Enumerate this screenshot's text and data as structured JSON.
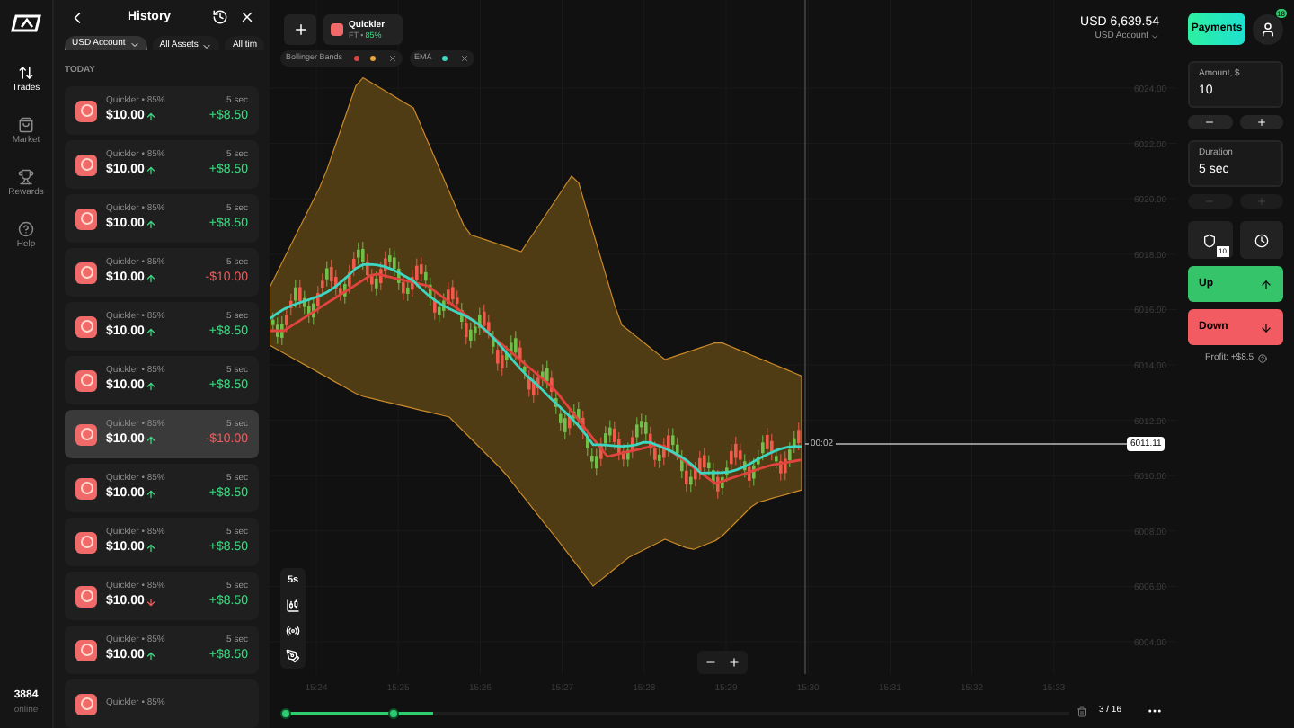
{
  "rail": {
    "items": [
      {
        "label": "Trades",
        "selected": true
      },
      {
        "label": "Market",
        "selected": false
      },
      {
        "label": "Rewards",
        "selected": false
      },
      {
        "label": "Help",
        "selected": false
      }
    ],
    "online_count": "3884",
    "online_label": "online"
  },
  "history": {
    "title": "History",
    "filters": [
      {
        "label": "USD Account",
        "selected": true
      },
      {
        "label": "All Assets",
        "selected": false
      },
      {
        "label": "All tim",
        "selected": false
      }
    ],
    "section": "TODAY",
    "trades": [
      {
        "title": "Quickler • 85%",
        "amount": "$10.00",
        "direction_up": true,
        "duration": "5 sec",
        "result": "+$8.50",
        "won": true,
        "highlighted": false
      },
      {
        "title": "Quickler • 85%",
        "amount": "$10.00",
        "direction_up": true,
        "duration": "5 sec",
        "result": "+$8.50",
        "won": true,
        "highlighted": false
      },
      {
        "title": "Quickler • 85%",
        "amount": "$10.00",
        "direction_up": true,
        "duration": "5 sec",
        "result": "+$8.50",
        "won": true,
        "highlighted": false
      },
      {
        "title": "Quickler • 85%",
        "amount": "$10.00",
        "direction_up": true,
        "duration": "5 sec",
        "result": "-$10.00",
        "won": false,
        "highlighted": false
      },
      {
        "title": "Quickler • 85%",
        "amount": "$10.00",
        "direction_up": true,
        "duration": "5 sec",
        "result": "+$8.50",
        "won": true,
        "highlighted": false
      },
      {
        "title": "Quickler • 85%",
        "amount": "$10.00",
        "direction_up": true,
        "duration": "5 sec",
        "result": "+$8.50",
        "won": true,
        "highlighted": false
      },
      {
        "title": "Quickler • 85%",
        "amount": "$10.00",
        "direction_up": true,
        "duration": "5 sec",
        "result": "-$10.00",
        "won": false,
        "highlighted": true
      },
      {
        "title": "Quickler • 85%",
        "amount": "$10.00",
        "direction_up": true,
        "duration": "5 sec",
        "result": "+$8.50",
        "won": true,
        "highlighted": false
      },
      {
        "title": "Quickler • 85%",
        "amount": "$10.00",
        "direction_up": true,
        "duration": "5 sec",
        "result": "+$8.50",
        "won": true,
        "highlighted": false
      },
      {
        "title": "Quickler • 85%",
        "amount": "$10.00",
        "direction_up": false,
        "duration": "5 sec",
        "result": "+$8.50",
        "won": true,
        "highlighted": false
      },
      {
        "title": "Quickler • 85%",
        "amount": "$10.00",
        "direction_up": true,
        "duration": "5 sec",
        "result": "+$8.50",
        "won": true,
        "highlighted": false
      },
      {
        "title": "Quickler • 85%",
        "highlighted": false
      }
    ]
  },
  "chart": {
    "asset": {
      "name": "Quickler",
      "type": "FT •",
      "payout": "85%"
    },
    "indicators": [
      {
        "name": "Bollinger Bands",
        "dots": [
          {
            "color": "#e0443e"
          },
          {
            "color": "#e8a33c"
          }
        ]
      },
      {
        "name": "EMA",
        "dots": [
          {
            "color": "#3dd6c0"
          }
        ]
      }
    ],
    "price_axis": [
      "6024.00",
      "6022.00",
      "6020.00",
      "6018.00",
      "6016.00",
      "6014.00",
      "6012.00",
      "6010.00",
      "6008.00",
      "6006.00",
      "6004.00"
    ],
    "time_axis": [
      "15:24",
      "15:25",
      "15:26",
      "15:27",
      "15:28",
      "15:29",
      "15:30",
      "15:31",
      "15:32",
      "15:33"
    ],
    "current_price": "6011.11",
    "timer": "00:02",
    "timeframe": "5s",
    "page": "3 / 16",
    "range": {
      "level": 0.19
    }
  },
  "account": {
    "balance": "USD 6,639.54",
    "name": "USD Account",
    "payments": "Payments",
    "badge": "18"
  },
  "trade_panel": {
    "amount_label": "Amount, $",
    "amount": "10",
    "duration_label": "Duration",
    "duration": "5 sec",
    "duration_steppers_disabled": true,
    "protection_badge": "10",
    "up": "Up",
    "down": "Down",
    "profit": "Profit: +$8.5"
  }
}
